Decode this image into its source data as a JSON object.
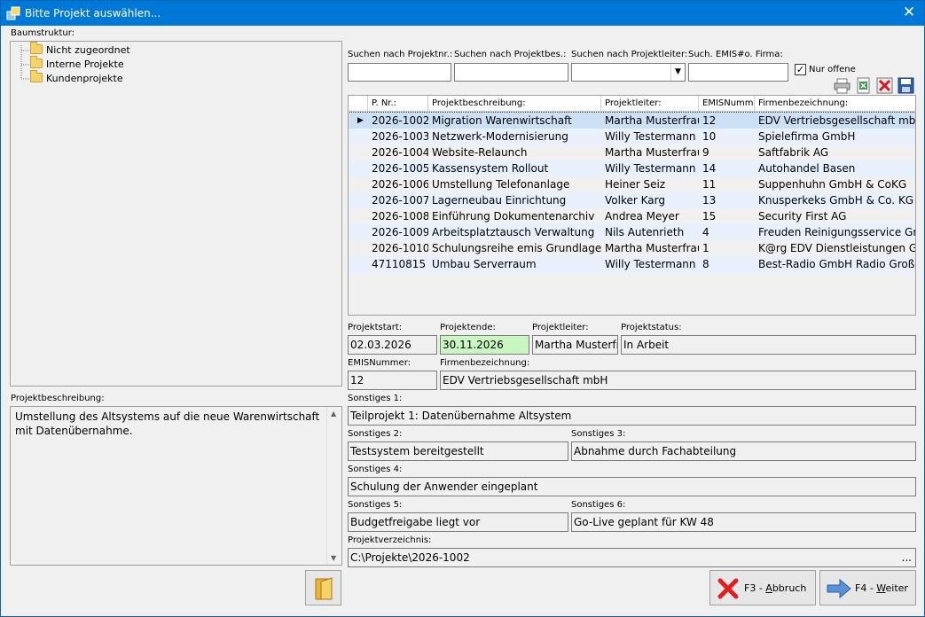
{
  "window": {
    "title": "Bitte Projekt auswählen...",
    "close": "✕"
  },
  "tree": {
    "label": "Baumstruktur:",
    "items": [
      "Nicht zugeordnet",
      "Interne Projekte",
      "Kundenprojekte"
    ]
  },
  "search": {
    "nr_label": "Suchen nach Projektnr.:",
    "bes_label": "Suchen nach Projektbes.:",
    "leiter_label": "Suchen nach Projektleiter:",
    "emis_label": "Such. EMIS#o. Firma:",
    "nur_offene_label": "Nur offene",
    "nur_offene_checked": true,
    "dropdown_arrow": "▼"
  },
  "grid": {
    "headers": [
      "P. Nr.:",
      "Projektbeschreibung:",
      "Projektleiter:",
      "EMISNumm",
      "Firmenbezeichnung:"
    ],
    "current_marker": "▶",
    "rows": [
      [
        "2026-1002",
        "Migration Warenwirtschaft",
        "Martha Musterfrau",
        "12",
        "EDV Vertriebsgesellschaft mbH"
      ],
      [
        "2026-1003",
        "Netzwerk-Modernisierung",
        "Willy Testermann",
        "10",
        "Spielefirma GmbH"
      ],
      [
        "2026-1004",
        "Website-Relaunch",
        "Martha Musterfrau",
        "9",
        "Saftfabrik AG"
      ],
      [
        "2026-1005",
        "Kassensystem Rollout",
        "Willy Testermann",
        "14",
        "Autohandel Basen"
      ],
      [
        "2026-1006",
        "Umstellung Telefonanlage",
        "Heiner Seiz",
        "11",
        "Suppenhuhn GmbH & CoKG"
      ],
      [
        "2026-1007",
        "Lagerneubau Einrichtung",
        "Volker Karg",
        "13",
        "Knusperkeks GmbH & Co. KG"
      ],
      [
        "2026-1008",
        "Einführung Dokumentenarchiv",
        "Andrea Meyer",
        "15",
        "Security First AG"
      ],
      [
        "2026-1009",
        "Arbeitsplatztausch Verwaltung",
        "Nils Autenrieth",
        "4",
        "Freuden Reinigungsservice GmbH"
      ],
      [
        "2026-1010",
        "Schulungsreihe emis Grundlagen",
        "Martha Musterfrau",
        "1",
        "K@rg EDV Dienstleistungen GmbH"
      ],
      [
        "47110815",
        "Umbau Serverraum",
        "Willy Testermann",
        "8",
        "Best-Radio GmbH Radio Großhandel"
      ]
    ]
  },
  "details": {
    "start_label": "Projektstart:",
    "start": "02.03.2026",
    "ende_label": "Projektende:",
    "ende": "30.11.2026",
    "leiter_label": "Projektleiter:",
    "leiter": "Martha Musterfrau",
    "status_label": "Projektstatus:",
    "status": "In Arbeit",
    "emis_label": "EMISNummer:",
    "emis": "12",
    "firma_label": "Firmenbezeichnung:",
    "firma": "EDV Vertriebsgesellschaft mbH",
    "s1_label": "Sonstiges 1:",
    "s1": "Teilprojekt 1: Datenübernahme Altsystem",
    "s2_label": "Sonstiges 2:",
    "s2": "Testsystem bereitgestellt",
    "s3_label": "Sonstiges 3:",
    "s3": "Abnahme durch Fachabteilung",
    "s4_label": "Sonstiges 4:",
    "s4": "Schulung der Anwender eingeplant",
    "s5_label": "Sonstiges 5:",
    "s5": "Budgetfreigabe liegt vor",
    "s6_label": "Sonstiges 6:",
    "s6": "Go-Live geplant für KW 48",
    "dir_label": "Projektverzeichnis:",
    "dir": "C:\\Projekte\\2026-1002",
    "dir_btn": "..."
  },
  "beschreibung": {
    "label": "Projektbeschreibung:",
    "text": "Umstellung des Altsystems auf die neue Warenwirtschaft mit Datenübernahme."
  },
  "buttons": {
    "abbruch_key": "F3 - ",
    "abbruch_u": "A",
    "abbruch_rest": "bbruch",
    "weiter_key": "F4 - ",
    "weiter_u": "W",
    "weiter_rest": "eiter"
  },
  "colors": {
    "title_bg": "#0078d7",
    "selected_row": "#cce0f5",
    "alt_row": "#e8f0fb",
    "ende_bg": "#c8f5c0"
  }
}
